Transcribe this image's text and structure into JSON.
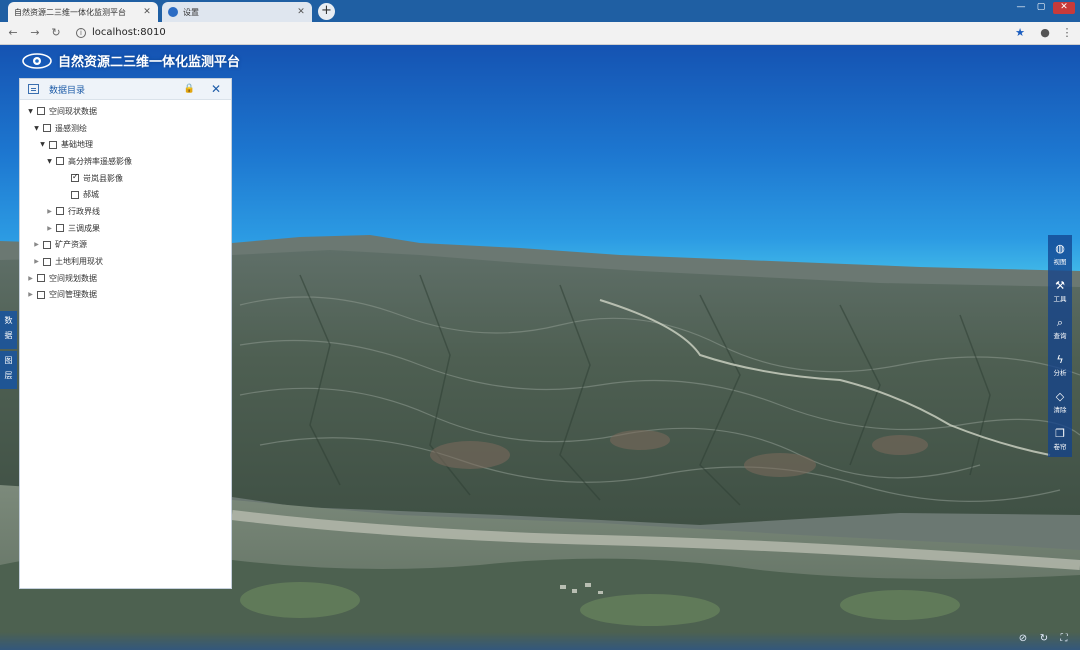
{
  "browser": {
    "tabs": [
      {
        "title": "自然资源二三维一体化监测平台",
        "active": true
      },
      {
        "title": "设置",
        "active": false
      }
    ],
    "url": "localhost:8010"
  },
  "app": {
    "title": "自然资源二三维一体化监测平台"
  },
  "catalog": {
    "title": "数据目录",
    "tree": [
      {
        "label": "空间现状数据",
        "checked": false
      },
      {
        "label": "遥感测绘",
        "checked": false
      },
      {
        "label": "基础地理",
        "checked": false
      },
      {
        "label": "高分辨率遥感影像",
        "checked": false
      },
      {
        "label": "岢岚县影像",
        "checked": true
      },
      {
        "label": "郝城",
        "checked": false
      },
      {
        "label": "行政界线",
        "checked": false
      },
      {
        "label": "三调成果",
        "checked": false
      },
      {
        "label": "矿产资源",
        "checked": false
      },
      {
        "label": "土地利用现状",
        "checked": false
      },
      {
        "label": "空间规划数据",
        "checked": false
      },
      {
        "label": "空间管理数据",
        "checked": false
      }
    ]
  },
  "side_tabs": [
    {
      "label": "数\n据"
    },
    {
      "label": "图\n层"
    }
  ],
  "toolbar": [
    {
      "label": "视图",
      "icon": "globe-icon"
    },
    {
      "label": "工具",
      "icon": "wrench-icon"
    },
    {
      "label": "查询",
      "icon": "search-icon"
    },
    {
      "label": "分析",
      "icon": "lightning-icon"
    },
    {
      "label": "清除",
      "icon": "eraser-icon"
    },
    {
      "label": "卷帘",
      "icon": "layers-icon"
    }
  ],
  "colors": {
    "browser_blue": "#1f5fa3",
    "panel_blue": "#1e5ca8",
    "toolbar_bg": "#12428c"
  }
}
